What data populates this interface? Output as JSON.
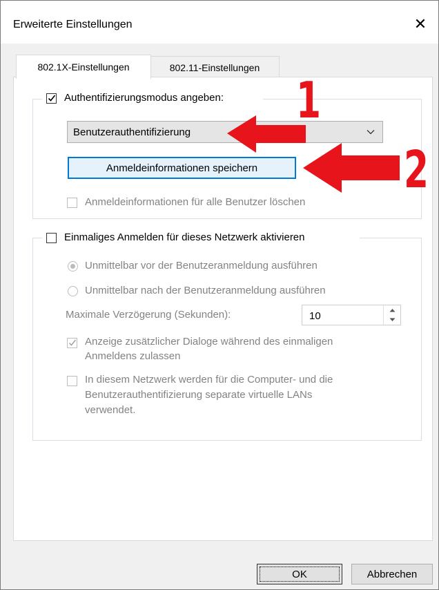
{
  "window": {
    "title": "Erweiterte Einstellungen",
    "close_glyph": "✕"
  },
  "tabs": [
    {
      "label": "802.1X-Einstellungen",
      "active": true
    },
    {
      "label": "802.11-Einstellungen",
      "active": false
    }
  ],
  "auth_group": {
    "checkbox_label": "Authentifizierungsmodus angeben:",
    "checked": true,
    "mode_select": {
      "selected": "Benutzerauthentifizierung"
    },
    "save_credentials_button": "Anmeldeinformationen speichern",
    "delete_credentials_label": "Anmeldeinformationen für alle Benutzer löschen",
    "delete_credentials_checked": false
  },
  "sso_group": {
    "checkbox_label": "Einmaliges Anmelden für dieses Netzwerk aktivieren",
    "checked": false,
    "radio_before": "Unmittelbar vor der Benutzeranmeldung ausführen",
    "radio_after": "Unmittelbar nach der Benutzeranmeldung ausführen",
    "delay_label": "Maximale Verzögerung (Sekunden):",
    "delay_value": "10",
    "show_dialogs_line1": "Anzeige zusätzlicher Dialoge während des einmaligen",
    "show_dialogs_line2": "Anmeldens zulassen",
    "show_dialogs_checked": true,
    "vlan_line1": "In diesem Netzwerk werden für die Computer- und die",
    "vlan_line2": "Benutzerauthentifizierung separate virtuelle LANs",
    "vlan_line3": "verwendet.",
    "vlan_checked": false
  },
  "footer": {
    "ok_label": "OK",
    "cancel_label": "Abbrechen"
  },
  "annotations": {
    "marker_1": "1",
    "marker_2": "2",
    "color": "#e8141c"
  },
  "colors": {
    "focus_blue": "#0078d7",
    "disabled_text": "#838383"
  }
}
